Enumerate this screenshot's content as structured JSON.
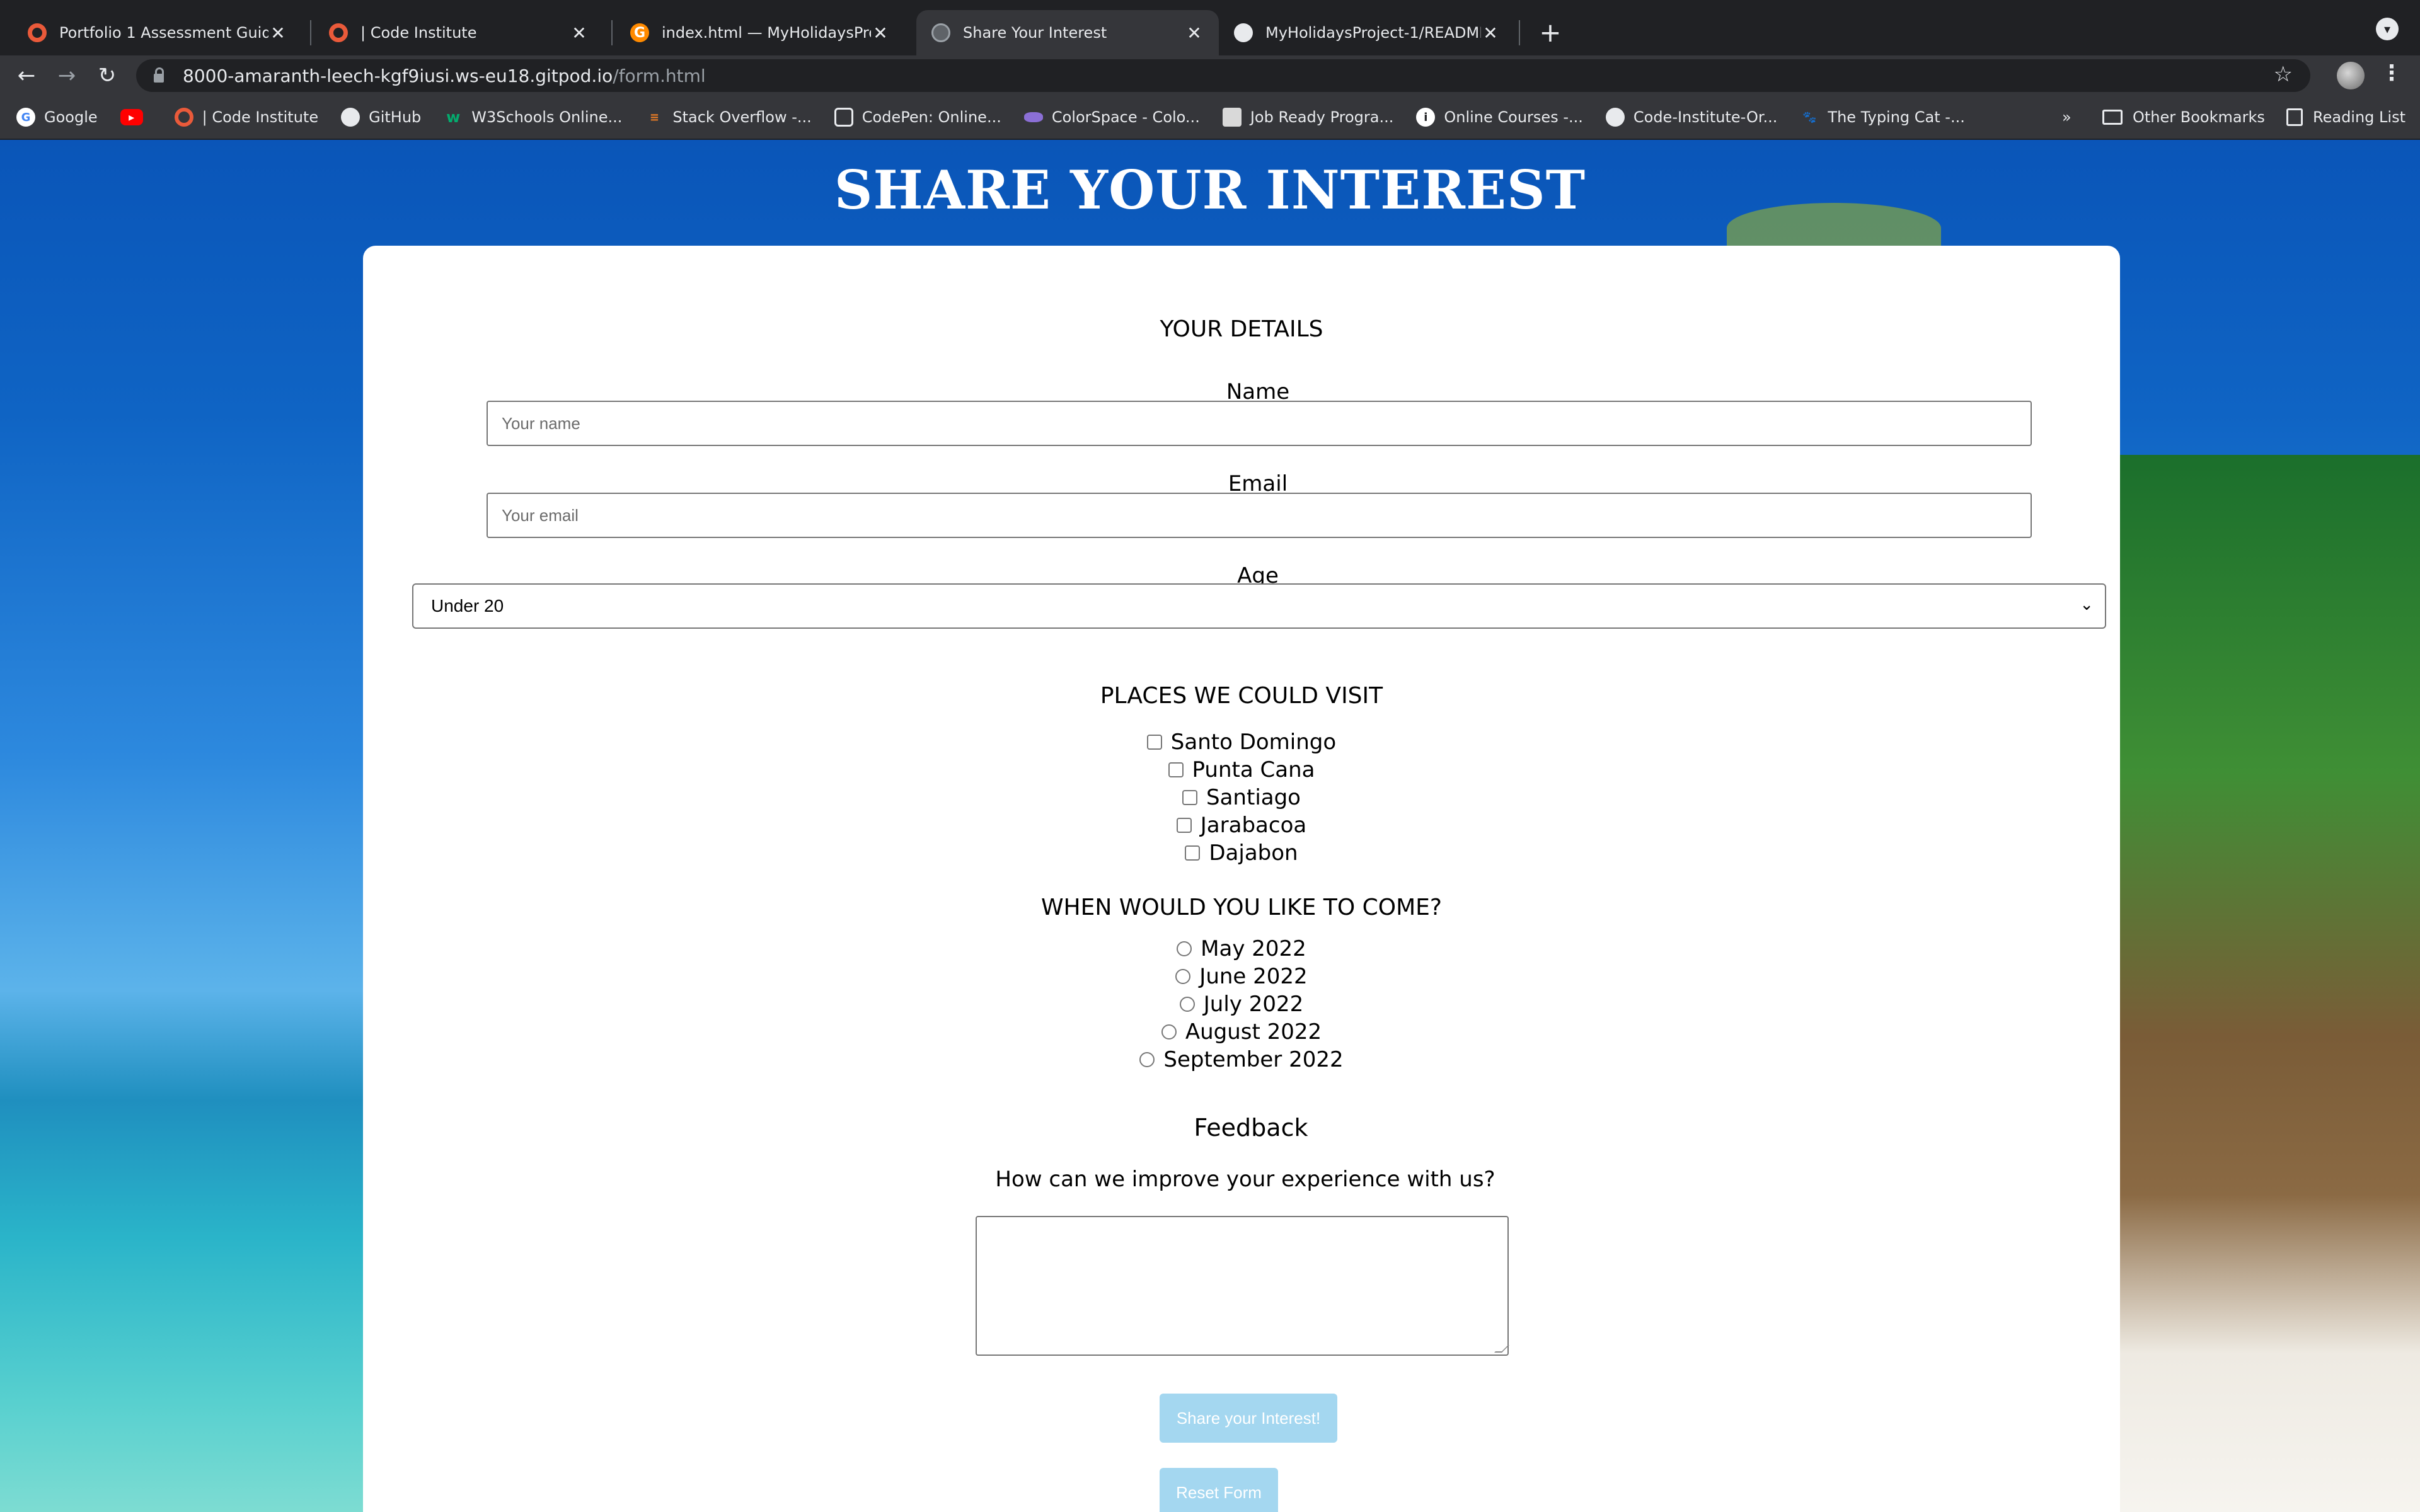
{
  "browser": {
    "tabs": [
      {
        "title": "Portfolio 1 Assessment Guide |",
        "favicon": "code-institute-icon"
      },
      {
        "title": "| Code Institute",
        "favicon": "code-institute-icon"
      },
      {
        "title": "index.html — MyHolidaysProje",
        "favicon": "gitpod-icon"
      },
      {
        "title": "Share Your Interest",
        "favicon": "globe-icon",
        "active": true
      },
      {
        "title": "MyHolidaysProject-1/README.",
        "favicon": "github-icon"
      }
    ],
    "url_host": "8000-amaranth-leech-kgf9iusi.ws-eu18.gitpod.io",
    "url_path": "/form.html",
    "bookmarks": [
      {
        "label": "Google",
        "icon": "google-icon"
      },
      {
        "label": "",
        "icon": "youtube-icon"
      },
      {
        "label": "| Code Institute",
        "icon": "code-institute-icon"
      },
      {
        "label": "GitHub",
        "icon": "github-icon"
      },
      {
        "label": "W3Schools Online...",
        "icon": "w3schools-icon"
      },
      {
        "label": "Stack Overflow -...",
        "icon": "stackoverflow-icon"
      },
      {
        "label": "CodePen: Online...",
        "icon": "codepen-icon"
      },
      {
        "label": "ColorSpace - Colo...",
        "icon": "colorspace-icon"
      },
      {
        "label": "Job Ready Progra...",
        "icon": "job-ready-icon"
      },
      {
        "label": "Online Courses -...",
        "icon": "online-courses-icon"
      },
      {
        "label": "Code-Institute-Or...",
        "icon": "github-icon"
      },
      {
        "label": "The Typing Cat -...",
        "icon": "typing-cat-icon"
      }
    ],
    "overflow_chevron": "»",
    "other_bookmarks": "Other Bookmarks",
    "reading_list": "Reading List"
  },
  "page": {
    "title": "SHARE YOUR INTEREST",
    "details_heading": "YOUR DETAILS",
    "name_label": "Name",
    "name_placeholder": "Your name",
    "email_label": "Email",
    "email_placeholder": "Your email",
    "age_label": "Age",
    "age_selected": "Under 20",
    "places_heading": "PLACES WE COULD VISIT",
    "places": [
      "Santo Domingo",
      "Punta Cana",
      "Santiago",
      "Jarabacoa",
      "Dajabon"
    ],
    "when_heading": "WHEN WOULD YOU LIKE TO COME?",
    "dates": [
      "May 2022",
      "June 2022",
      "July 2022",
      "August 2022",
      "September 2022"
    ],
    "feedback_heading": "Feedback",
    "feedback_question": "How can we improve your experience with us?",
    "submit_label": "Share your Interest!",
    "reset_label": "Reset Form"
  },
  "colors": {
    "button_bg": "#a4d7f0",
    "title_text": "#ffffff",
    "sky_blue": "#0a55b8",
    "sea_turquoise": "#58d0cf"
  }
}
